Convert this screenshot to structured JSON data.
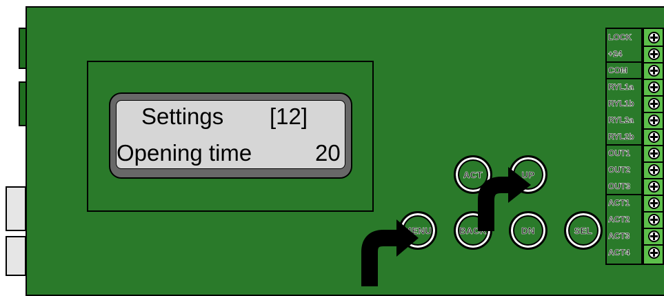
{
  "display": {
    "line1_left": "Settings",
    "line1_right": "[12]",
    "line2_left": "Opening time",
    "line2_right": "20"
  },
  "buttons": {
    "act": "ACT",
    "up": "UP",
    "menu": "MENU",
    "back": "BACK",
    "dn": "DN",
    "sel": "SEL"
  },
  "terminals": [
    "LOCK",
    "+24",
    "COM",
    "RYL1a",
    "RYL1b",
    "RYL2a",
    "RYL2b",
    "OUT1",
    "OUT2",
    "OUT3",
    "ACT1",
    "ACT2",
    "ACT3",
    "ACT4"
  ],
  "colors": {
    "board": "#2a7a2a",
    "terminal_block": "#5cbf4a",
    "lcd_screen": "#d6d6d6",
    "lcd_bezel": "#686868"
  }
}
